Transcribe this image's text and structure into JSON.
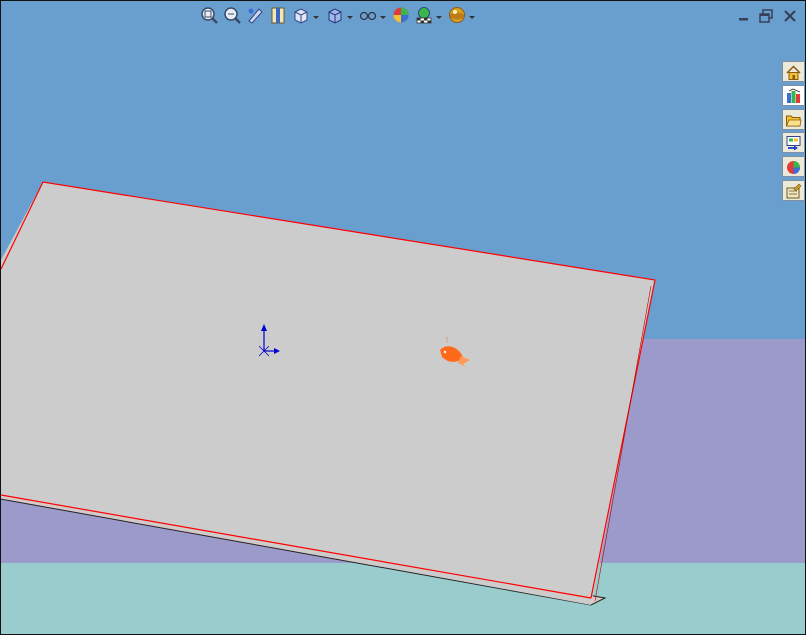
{
  "colors": {
    "sky": "#699fcf",
    "floor_far": "#9c9acb",
    "floor_near": "#99cccc",
    "plane_face": "#cccccc",
    "plane_edge": "#ff0000",
    "axis": "#0000cc",
    "mate_part": "#ff6a1a"
  },
  "heads_up_toolbar": {
    "items": [
      {
        "icon": "zoom-to-fit-icon"
      },
      {
        "icon": "zoom-to-area-icon"
      },
      {
        "icon": "previous-view-icon"
      },
      {
        "icon": "section-view-icon"
      },
      {
        "icon": "view-orientation-icon",
        "dropdown": true
      },
      {
        "icon": "display-style-icon",
        "dropdown": true
      },
      {
        "icon": "hide-show-items-icon",
        "dropdown": true
      },
      {
        "icon": "edit-appearance-icon"
      },
      {
        "icon": "apply-scene-icon",
        "dropdown": true
      },
      {
        "icon": "view-settings-icon",
        "dropdown": true
      }
    ]
  },
  "window_controls": {
    "items": [
      {
        "icon": "minimize-icon"
      },
      {
        "icon": "restore-icon"
      },
      {
        "icon": "close-icon"
      }
    ]
  },
  "task_pane": {
    "active_index": 1,
    "tabs": [
      {
        "icon": "home-icon"
      },
      {
        "icon": "design-library-icon"
      },
      {
        "icon": "file-explorer-icon"
      },
      {
        "icon": "view-palette-icon"
      },
      {
        "icon": "appearances-scenes-icon"
      },
      {
        "icon": "custom-properties-icon"
      }
    ]
  }
}
